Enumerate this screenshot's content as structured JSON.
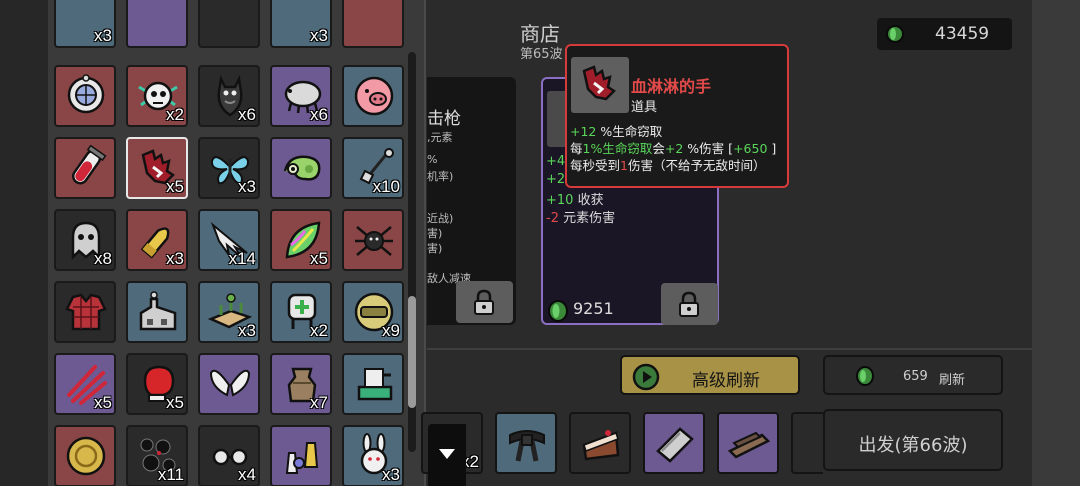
{
  "shop": {
    "title": "商店",
    "wave": "第65波",
    "money": "43459"
  },
  "inventory": {
    "items": [
      {
        "icon": "dreamcatcher-icon",
        "bg": "red",
        "qty": ""
      },
      {
        "icon": "eyeball-creature-icon",
        "bg": "red",
        "qty": "x2"
      },
      {
        "icon": "bat-icon",
        "bg": "dark",
        "qty": "x6"
      },
      {
        "icon": "tardigrade-icon",
        "bg": "purple",
        "qty": "x6"
      },
      {
        "icon": "pig-icon",
        "bg": "blue",
        "qty": ""
      },
      {
        "icon": "blood-vial-icon",
        "bg": "red",
        "qty": ""
      },
      {
        "icon": "bloody-hand-icon",
        "bg": "red",
        "qty": "x5",
        "selected": true
      },
      {
        "icon": "butterfly-icon",
        "bg": "dark",
        "qty": "x3"
      },
      {
        "icon": "chameleon-icon",
        "bg": "purple",
        "qty": ""
      },
      {
        "icon": "grabber-arm-icon",
        "bg": "blue",
        "qty": "x10"
      },
      {
        "icon": "ghost-icon",
        "bg": "dark",
        "qty": "x8"
      },
      {
        "icon": "bullet-icon",
        "bg": "red",
        "qty": "x3"
      },
      {
        "icon": "wing-shards-icon",
        "bg": "blue",
        "qty": "x14"
      },
      {
        "icon": "rainbow-leaf-icon",
        "bg": "red",
        "qty": "x5"
      },
      {
        "icon": "spider-icon",
        "bg": "red",
        "qty": ""
      },
      {
        "icon": "plaid-shirt-icon",
        "bg": "dark",
        "qty": ""
      },
      {
        "icon": "factory-icon",
        "bg": "blue",
        "qty": ""
      },
      {
        "icon": "garden-bed-icon",
        "bg": "blue",
        "qty": "x3"
      },
      {
        "icon": "medkit-robot-icon",
        "bg": "blue",
        "qty": "x2"
      },
      {
        "icon": "helmet-icon",
        "bg": "blue",
        "qty": "x9"
      },
      {
        "icon": "claw-marks-icon",
        "bg": "purple",
        "qty": "x5"
      },
      {
        "icon": "boxing-glove-icon",
        "bg": "dark",
        "qty": "x5"
      },
      {
        "icon": "angel-wings-icon",
        "bg": "purple",
        "qty": ""
      },
      {
        "icon": "sack-icon",
        "bg": "purple",
        "qty": "x7"
      },
      {
        "icon": "sewing-machine-icon",
        "bg": "blue",
        "qty": ""
      },
      {
        "icon": "gold-coin-icon",
        "bg": "red",
        "qty": ""
      },
      {
        "icon": "bubbles-icon",
        "bg": "dark",
        "qty": "x11"
      },
      {
        "icon": "glasses-icon",
        "bg": "dark",
        "qty": "x4"
      },
      {
        "icon": "potion-set-icon",
        "bg": "purple",
        "qty": ""
      },
      {
        "icon": "bunny-icon",
        "bg": "blue",
        "qty": "x3"
      }
    ]
  },
  "card_left": {
    "title": "击枪",
    "lines": [
      ",元素",
      "%",
      "机率)",
      "近战)",
      "害)",
      "害)",
      "敌人减速"
    ]
  },
  "card_right": {
    "line1_val": "+4",
    "line2_val": "+2",
    "line3_val": "+10",
    "line3_text": "收获",
    "line4_val": "-2",
    "line4_text": "元素伤害",
    "price": "9251"
  },
  "tooltip": {
    "name": "血淋淋的手",
    "category": "道具",
    "line1_val": "+12",
    "line1_text": "%生命窃取",
    "line2_a": "每",
    "line2_b": "1%生命窃取",
    "line2_c": "会",
    "line2_d": "+2",
    "line2_e": "%伤害",
    "line2_f": "[",
    "line2_g": "+650",
    "line2_h": "]",
    "line3_a": "每秒受到",
    "line3_b": "1",
    "line3_c": "伤害（不给予无敌时间）"
  },
  "buttons": {
    "advanced_refresh": "高级刷新",
    "refresh_cost": "659",
    "refresh": "刷新",
    "depart": "出发(第66波)"
  },
  "owned_items": [
    {
      "icon": "unknown-item-icon",
      "bg": "dark",
      "qty": "x2"
    },
    {
      "icon": "black-belt-icon",
      "bg": "blue",
      "qty": ""
    },
    {
      "icon": "cake-slice-icon",
      "bg": "dark",
      "qty": ""
    },
    {
      "icon": "metal-plate-icon",
      "bg": "purple",
      "qty": ""
    },
    {
      "icon": "wood-planks-icon",
      "bg": "purple",
      "qty": ""
    },
    {
      "icon": "partial-item-icon",
      "bg": "dark",
      "qty": ""
    }
  ],
  "colors": {
    "accent_gold": "#a89246",
    "tooltip_border": "#d63a3a",
    "positive": "#5ad65a",
    "negative": "#e24a4a",
    "card_border": "#8a6fc2"
  }
}
